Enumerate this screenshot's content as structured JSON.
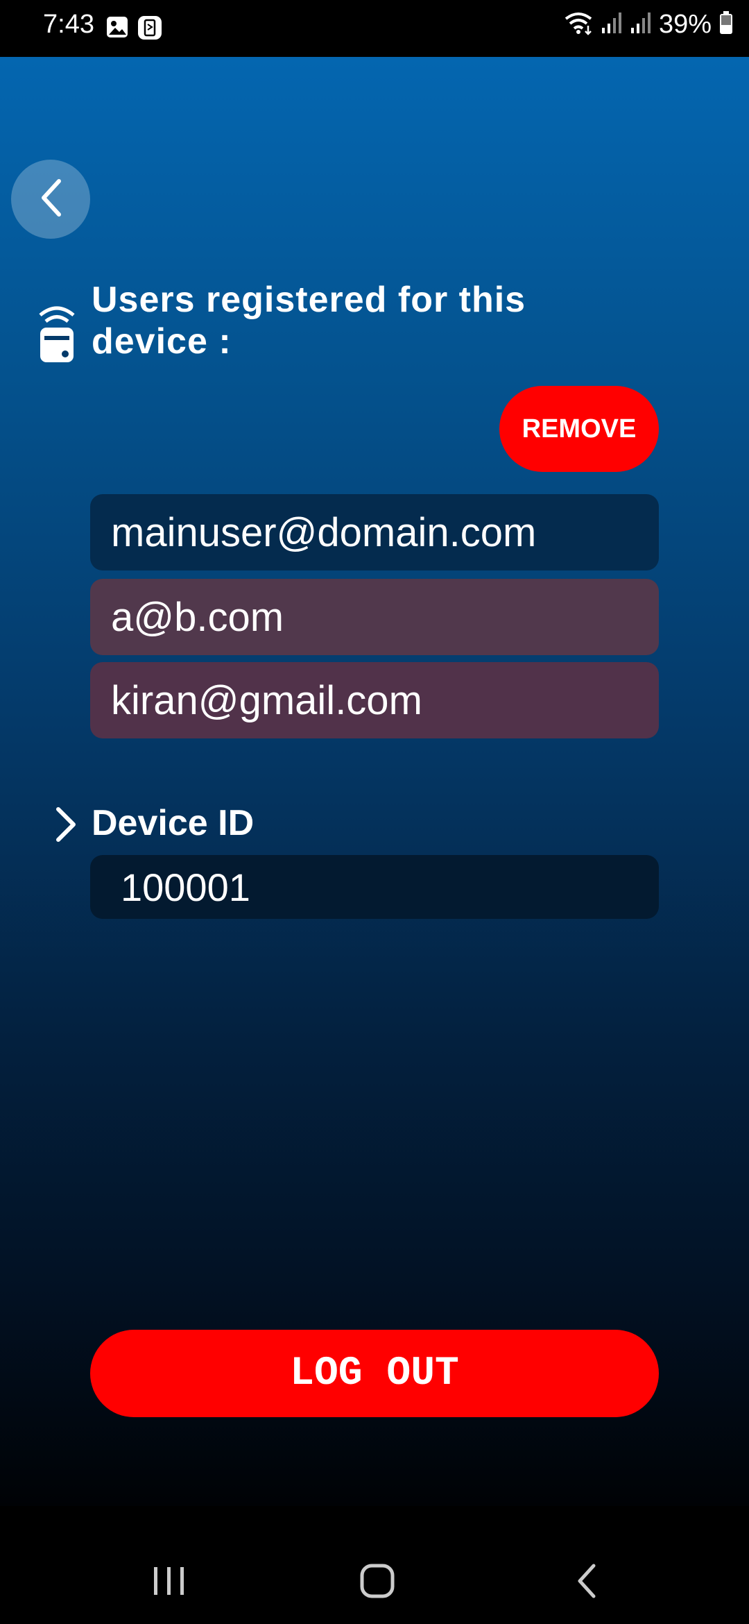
{
  "status_bar": {
    "time": "7:43",
    "battery": "39%",
    "icons": [
      "gallery-icon",
      "app-notification-icon",
      "wifi-icon",
      "signal-icon",
      "signal-icon",
      "battery-icon"
    ]
  },
  "header": {
    "back_icon": "chevron-left-icon"
  },
  "users_section": {
    "title": "Users registered for this device :",
    "icon": "remote-device-icon",
    "remove_label": "REMOVE",
    "users": [
      "mainuser@domain.com",
      "a@b.com",
      "kiran@gmail.com"
    ]
  },
  "device": {
    "label": "Device ID",
    "icon": "chevron-right-icon",
    "value": "100001"
  },
  "logout_label": "LOG OUT",
  "nav": {
    "icons": [
      "recent-apps-icon",
      "home-icon",
      "back-icon"
    ]
  },
  "colors": {
    "accent": "#ff0000",
    "primary_item": "#042b4e",
    "selected_item": "#51384c"
  }
}
